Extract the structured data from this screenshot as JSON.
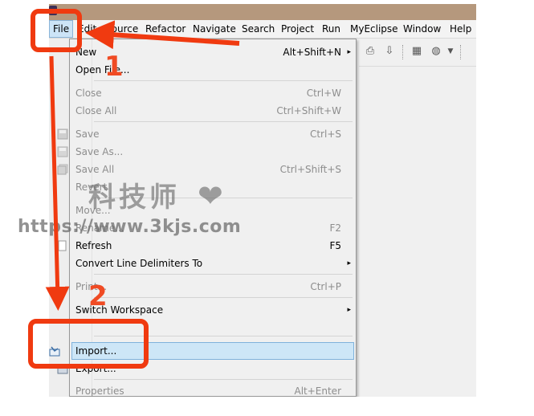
{
  "menubar": {
    "items": [
      {
        "name": "file",
        "label": "File"
      },
      {
        "name": "edit",
        "label": "Edit"
      },
      {
        "name": "source",
        "label": "Source"
      },
      {
        "name": "refactor",
        "label": "Refactor"
      },
      {
        "name": "navigate",
        "label": "Navigate"
      },
      {
        "name": "search",
        "label": "Search"
      },
      {
        "name": "project",
        "label": "Project"
      },
      {
        "name": "run",
        "label": "Run"
      },
      {
        "name": "myeclipse",
        "label": "MyEclipse"
      },
      {
        "name": "window",
        "label": "Window"
      },
      {
        "name": "help",
        "label": "Help"
      }
    ]
  },
  "file_menu": {
    "items": [
      {
        "label": "New",
        "shortcut": "Alt+Shift+N",
        "submenu": "▸"
      },
      {
        "label": "Open File..."
      },
      {
        "label": "Close",
        "shortcut": "Ctrl+W"
      },
      {
        "label": "Close All",
        "shortcut": "Ctrl+Shift+W"
      },
      {
        "label": "Save",
        "shortcut": "Ctrl+S"
      },
      {
        "label": "Save As..."
      },
      {
        "label": "Save All",
        "shortcut": "Ctrl+Shift+S"
      },
      {
        "label": "Revert"
      },
      {
        "label": "Move..."
      },
      {
        "label": "Rename...",
        "shortcut": "F2"
      },
      {
        "label": "Refresh",
        "shortcut": "F5"
      },
      {
        "label": "Convert Line Delimiters To",
        "submenu": "▸"
      },
      {
        "label": "Print...",
        "shortcut": "Ctrl+P"
      },
      {
        "label": "Switch Workspace",
        "submenu": "▸"
      },
      {
        "label": "Import..."
      },
      {
        "label": "Export..."
      },
      {
        "label": "Properties",
        "shortcut": "Alt+Enter"
      }
    ]
  },
  "watermark": {
    "cn_text": "科技师",
    "heart": "❤",
    "url": "https://www.3kjs.com"
  },
  "annotations": {
    "step1": "1",
    "step2": "2"
  },
  "colors": {
    "accent": "#f03a10",
    "highlight": "#cde6f7",
    "titlebar": "#b5987d"
  }
}
